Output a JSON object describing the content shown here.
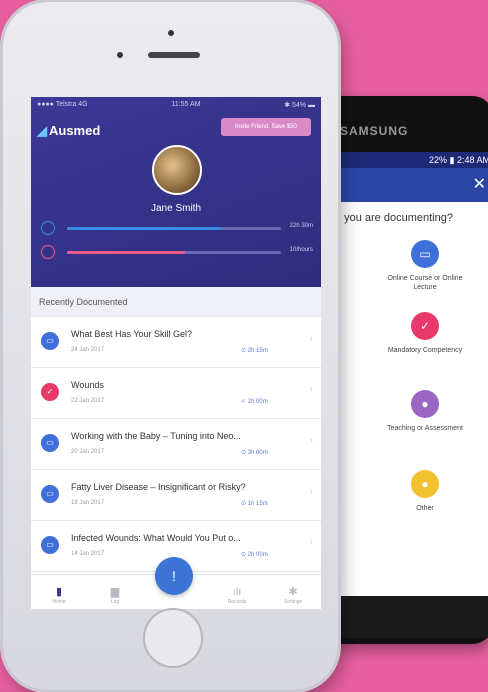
{
  "samsung": {
    "brand": "SAMSUNG",
    "status": "22% ▮ 2:48 AM",
    "close": "✕",
    "question": "t you are documenting?",
    "options": [
      {
        "label": "Online Course or Online Lecture",
        "color": "#3f6fd8",
        "icon": "document-icon",
        "glyph": "▭"
      },
      {
        "label": "Mandatory Competency",
        "color": "#e8396a",
        "icon": "check-icon",
        "glyph": "✓"
      },
      {
        "label": "Teaching or Assessment",
        "color": "#9b66c2",
        "icon": "teaching-icon",
        "glyph": "●"
      },
      {
        "label": "Other",
        "color": "#f2c12e",
        "icon": "other-icon",
        "glyph": "●"
      }
    ]
  },
  "app": {
    "status_left": "●●●● Telstra 4G",
    "status_time": "11:55 AM",
    "status_right": "✱ 54% ▬",
    "logo_text": "Ausmed",
    "logo_mark": "◢",
    "invite_label": "Invite Friend, Save $50",
    "user_name": "Jane Smith",
    "progress": [
      {
        "label": "22h 30m",
        "fraction": 0.72,
        "color": "#3a8be8",
        "ring": "#3a8be8"
      },
      {
        "label": "10/hours",
        "fraction": 0.55,
        "color": "#ee5a8e",
        "ring": "#ee5a8e"
      }
    ],
    "section_title": "Recently Documented",
    "items": [
      {
        "title": "What Best Has Your Skill Gel?",
        "date": "24 Jan 2017",
        "meta": "⊙ 2h 15m",
        "icon": "document-icon",
        "color": "#3f6fd8",
        "glyph": "▭"
      },
      {
        "title": "Wounds",
        "date": "22 Jan 2017",
        "meta": "✓ 2h 00m",
        "icon": "check-icon",
        "color": "#e8396a",
        "glyph": "✓"
      },
      {
        "title": "Working with the Baby – Tuning into Neo...",
        "date": "20 Jan 2017",
        "meta": "⊙ 3h 00m",
        "icon": "document-icon",
        "color": "#3f6fd8",
        "glyph": "▭"
      },
      {
        "title": "Fatty Liver Disease – Insignificant or Risky?",
        "date": "18 Jan 2017",
        "meta": "⊙ 1h 15m",
        "icon": "document-icon",
        "color": "#3f6fd8",
        "glyph": "▭"
      },
      {
        "title": "Infected Wounds: What Would You Put o...",
        "date": "14 Jan 2017",
        "meta": "⊙ 2h 00m",
        "icon": "document-icon",
        "color": "#3f6fd8",
        "glyph": "▭"
      }
    ],
    "tabs": [
      {
        "label": "Home",
        "glyph": "▮",
        "icon": "home-icon"
      },
      {
        "label": "Log",
        "glyph": "▆",
        "icon": "log-icon"
      },
      {
        "label": "Records",
        "glyph": "ılı",
        "icon": "records-icon"
      },
      {
        "label": "Settings",
        "glyph": "✱",
        "icon": "settings-icon"
      }
    ],
    "fab": "!"
  }
}
